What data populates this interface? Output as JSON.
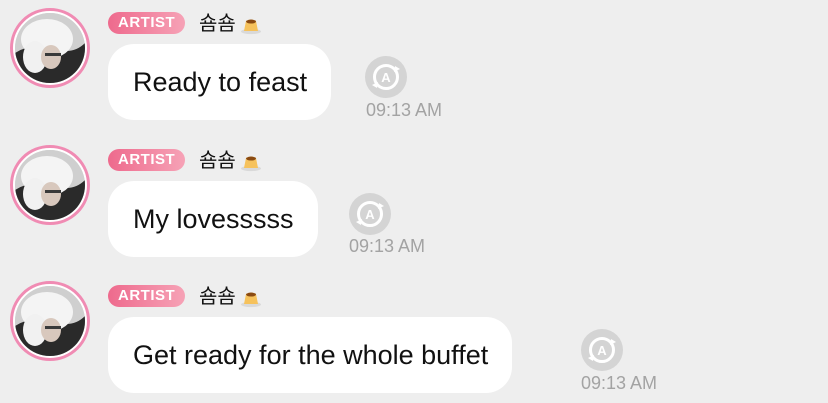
{
  "messages": [
    {
      "badge": "ARTIST",
      "sender": "숌숌",
      "text": "Ready to feast",
      "time": "09:13 AM",
      "translate_icon": "translate-a-icon",
      "sender_emoji_icon": "custard-pudding-icon"
    },
    {
      "badge": "ARTIST",
      "sender": "숌숌",
      "text": "My lovesssss",
      "time": "09:13 AM",
      "translate_icon": "translate-a-icon",
      "sender_emoji_icon": "custard-pudding-icon"
    },
    {
      "badge": "ARTIST",
      "sender": "숌숌",
      "text": "Get ready for the whole buffet",
      "time": "09:13 AM",
      "translate_icon": "translate-a-icon",
      "sender_emoji_icon": "custard-pudding-icon"
    }
  ],
  "colors": {
    "background": "#eeeeee",
    "bubble": "#ffffff",
    "badge_start": "#ee6a8d",
    "badge_end": "#f6a2b6",
    "avatar_ring": "#f08bb3",
    "timestamp": "#a3a3a3"
  }
}
